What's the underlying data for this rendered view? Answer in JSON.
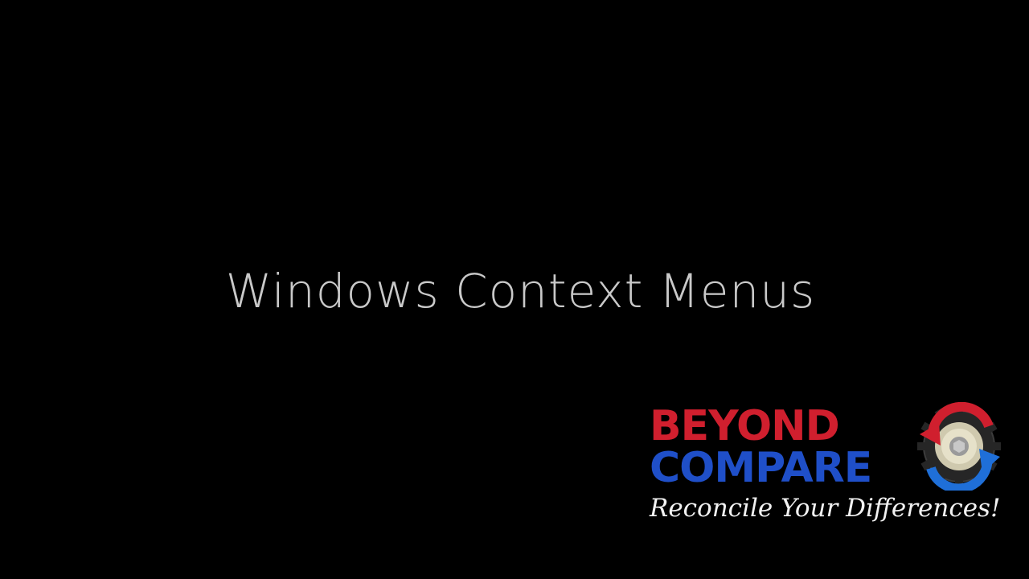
{
  "slide": {
    "title": "Windows Context Menus"
  },
  "logo": {
    "line1": "BEYOND",
    "line2": "COMPARE",
    "tagline": "Reconcile Your Differences!",
    "emblem_icon": "gear-arrows-icon",
    "colors": {
      "red": "#d01f2e",
      "blue": "#1f4fc8",
      "gear": "#2a2a2a",
      "bolt": "#d8d2b8"
    }
  },
  "colors": {
    "background": "#000000",
    "title_text": "#c9c9c9"
  }
}
